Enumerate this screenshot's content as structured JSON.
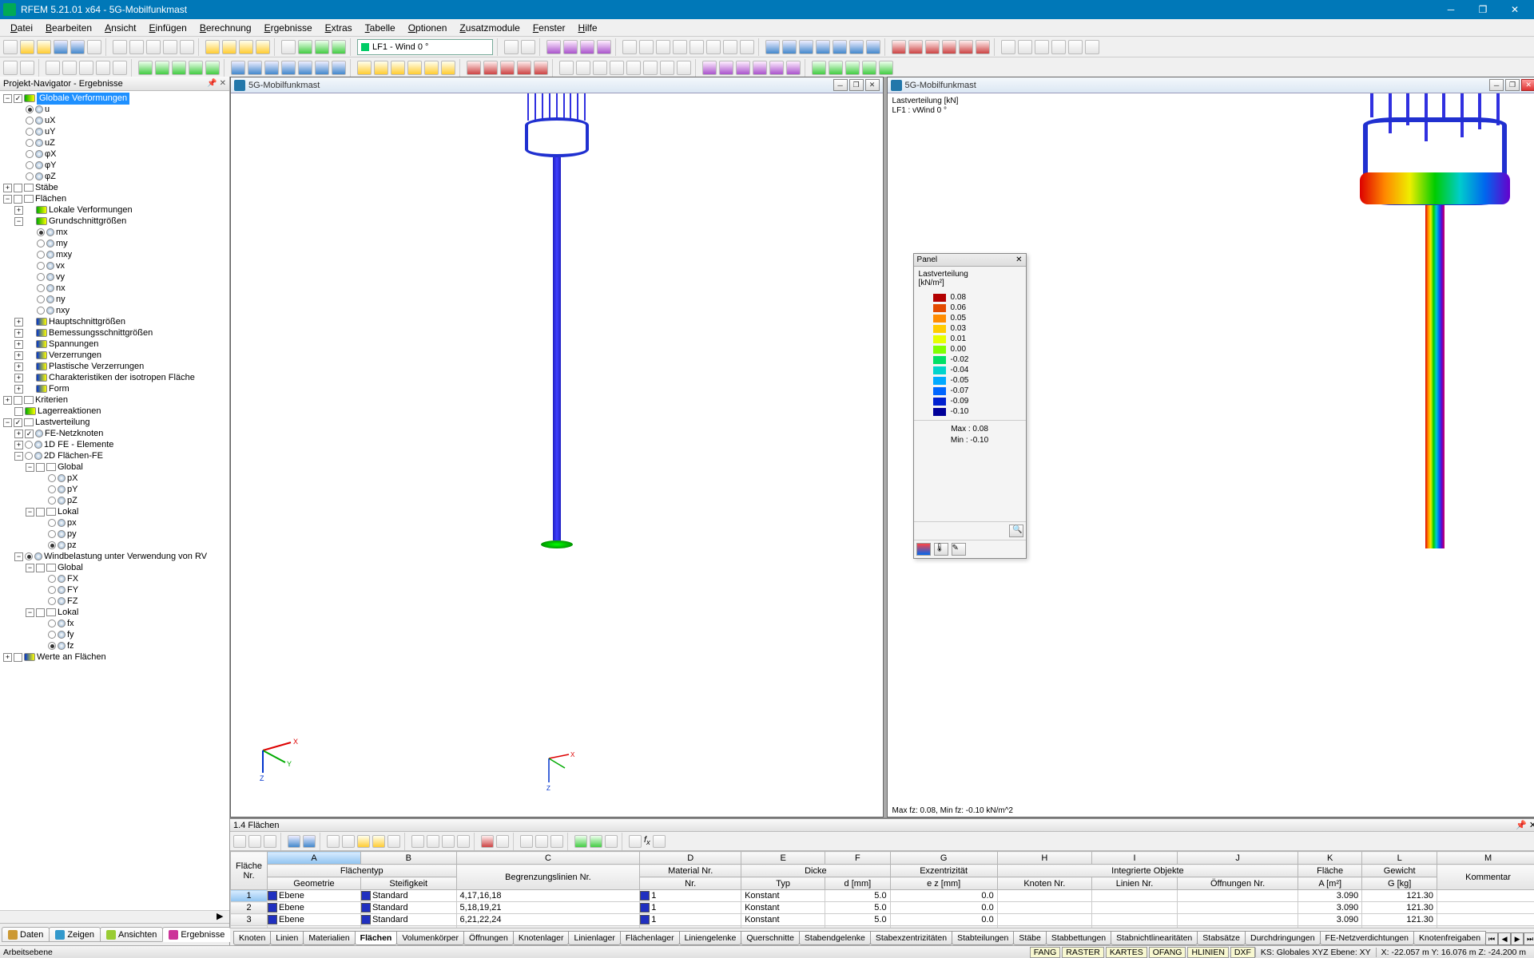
{
  "app": {
    "title": "RFEM 5.21.01 x64 - 5G-Mobilfunkmast"
  },
  "menu": [
    "Datei",
    "Bearbeiten",
    "Ansicht",
    "Einfügen",
    "Berechnung",
    "Ergebnisse",
    "Extras",
    "Tabelle",
    "Optionen",
    "Zusatzmodule",
    "Fenster",
    "Hilfe"
  ],
  "lfcombo": "LF1 - Wind 0 °",
  "navigator": {
    "title": "Projekt-Navigator - Ergebnisse",
    "tabs": [
      "Daten",
      "Zeigen",
      "Ansichten",
      "Ergebnisse"
    ],
    "root": "Globale Verformungen",
    "items_u": [
      "u",
      "uX",
      "uY",
      "uZ",
      "φX",
      "φY",
      "φZ"
    ],
    "staebe": "Stäbe",
    "flaechen": "Flächen",
    "lokverf": "Lokale Verformungen",
    "grund": "Grundschnittgrößen",
    "grund_items": [
      "mx",
      "my",
      "mxy",
      "vx",
      "vy",
      "nx",
      "ny",
      "nxy"
    ],
    "more": [
      "Hauptschnittgrößen",
      "Bemessungsschnittgrößen",
      "Spannungen",
      "Verzerrungen",
      "Plastische Verzerrungen",
      "Charakteristiken der isotropen Fläche",
      "Form"
    ],
    "kriterien": "Kriterien",
    "lager": "Lagerreaktionen",
    "lastvert": "Lastverteilung",
    "fenet": "FE-Netzknoten",
    "fe1d": "1D FE - Elemente",
    "fe2d": "2D Flächen-FE",
    "global": "Global",
    "lokal": "Lokal",
    "pitems": [
      "pX",
      "pY",
      "pZ"
    ],
    "pitems2": [
      "px",
      "py",
      "pz"
    ],
    "wind": "Windbelastung unter Verwendung von RV",
    "fitems": [
      "FX",
      "FY",
      "FZ"
    ],
    "fitems2": [
      "fx",
      "fy",
      "fz"
    ],
    "werte": "Werte an Flächen"
  },
  "view1": {
    "title": "5G-Mobilfunkmast"
  },
  "view2": {
    "title": "5G-Mobilfunkmast",
    "info1": "Lastverteilung [kN]",
    "info2": "LF1 : vWind 0 °",
    "footer": "Max fz: 0.08, Min fz: -0.10 kN/m^2"
  },
  "panel": {
    "title": "Panel",
    "label": "Lastverteilung",
    "unit": "[kN/m²]",
    "legend": [
      {
        "v": " 0.08",
        "c": "#b30000"
      },
      {
        "v": " 0.06",
        "c": "#e34a00"
      },
      {
        "v": " 0.05",
        "c": "#ff8c00"
      },
      {
        "v": " 0.03",
        "c": "#ffcc00"
      },
      {
        "v": " 0.01",
        "c": "#e6ff00"
      },
      {
        "v": " 0.00",
        "c": "#80ff00"
      },
      {
        "v": "-0.02",
        "c": "#00e066"
      },
      {
        "v": "-0.04",
        "c": "#00d4cc"
      },
      {
        "v": "-0.05",
        "c": "#00aaff"
      },
      {
        "v": "-0.07",
        "c": "#0066ff"
      },
      {
        "v": "-0.09",
        "c": "#0020d0"
      },
      {
        "v": "-0.10",
        "c": "#000099"
      }
    ],
    "max": "Max  :   0.08",
    "min": "Min   :  -0.10"
  },
  "grid": {
    "title": "1.4 Flächen",
    "letters": [
      "A",
      "B",
      "C",
      "D",
      "E",
      "F",
      "G",
      "H",
      "I",
      "J",
      "K",
      "L",
      "M"
    ],
    "hdr1": {
      "flnr": "Fläche Nr.",
      "ftyp": "Flächentyp",
      "mat": "Material Nr.",
      "dicke": "Dicke",
      "exz": "Exzentrizität",
      "intobj": "Integrierte Objekte",
      "flaeche": "Fläche",
      "gewicht": "Gewicht",
      "komm": "Kommentar"
    },
    "hdr2": {
      "geom": "Geometrie",
      "steif": "Steifigkeit",
      "begr": "Begrenzungslinien Nr.",
      "typ": "Typ",
      "dmm": "d [mm]",
      "ez": "e z [mm]",
      "knoten": "Knoten Nr.",
      "linien": "Linien Nr.",
      "oeff": "Öffnungen Nr.",
      "am2": "A [m²]",
      "gkg": "G [kg]"
    },
    "rows": [
      {
        "nr": "1",
        "geom": "Ebene",
        "steif": "Standard",
        "begr": "4,17,16,18",
        "mat": "1",
        "typ": "Konstant",
        "d": "5.0",
        "ez": "0.0",
        "a": "3.090",
        "g": "121.30"
      },
      {
        "nr": "2",
        "geom": "Ebene",
        "steif": "Standard",
        "begr": "5,18,19,21",
        "mat": "1",
        "typ": "Konstant",
        "d": "5.0",
        "ez": "0.0",
        "a": "3.090",
        "g": "121.30"
      },
      {
        "nr": "3",
        "geom": "Ebene",
        "steif": "Standard",
        "begr": "6,21,22,24",
        "mat": "1",
        "typ": "Konstant",
        "d": "5.0",
        "ez": "0.0",
        "a": "3.090",
        "g": "121.30"
      }
    ],
    "tabs": [
      "Knoten",
      "Linien",
      "Materialien",
      "Flächen",
      "Volumenkörper",
      "Öffnungen",
      "Knotenlager",
      "Linienlager",
      "Flächenlager",
      "Liniengelenke",
      "Querschnitte",
      "Stabendgelenke",
      "Stabexzentrizitäten",
      "Stabteilungen",
      "Stäbe",
      "Stabbettungen",
      "Stabnichtlinearitäten",
      "Stabsätze",
      "Durchdringungen",
      "FE-Netzverdichtungen",
      "Knotenfreigaben"
    ]
  },
  "status": {
    "left": "Arbeitsebene",
    "tags": [
      "FANG",
      "RASTER",
      "KARTES",
      "OFANG",
      "HLINIEN",
      "DXF"
    ],
    "ks": "KS: Globales XYZ Ebene: XY",
    "coords": "X:  -22.057 m    Y:   16.076 m    Z:  -24.200 m"
  }
}
